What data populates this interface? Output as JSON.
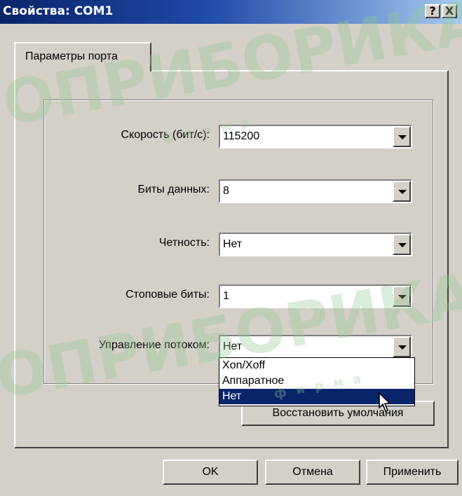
{
  "window": {
    "title": "Свойства: COM1",
    "help_label": "?",
    "close_label": "X"
  },
  "tabs": [
    {
      "label": "Параметры порта"
    }
  ],
  "settings": [
    {
      "label": "Скорость (бит/с):",
      "value": "115200"
    },
    {
      "label": "Биты данных:",
      "value": "8"
    },
    {
      "label": "Четность:",
      "value": "Нет"
    },
    {
      "label": "Стоповые биты:",
      "value": "1"
    },
    {
      "label": "Управление потоком:",
      "value": "Нет"
    }
  ],
  "flow_dropdown": {
    "options": [
      "Xon/Xoff",
      "Аппаратное",
      "Нет"
    ],
    "highlighted": "Нет"
  },
  "buttons": {
    "restore_defaults": "Восстановить умолчания",
    "ok": "OK",
    "cancel": "Отмена",
    "apply": "Применить"
  },
  "watermark": {
    "brand": "ОПРИБОРИКА",
    "word": "фирма"
  }
}
